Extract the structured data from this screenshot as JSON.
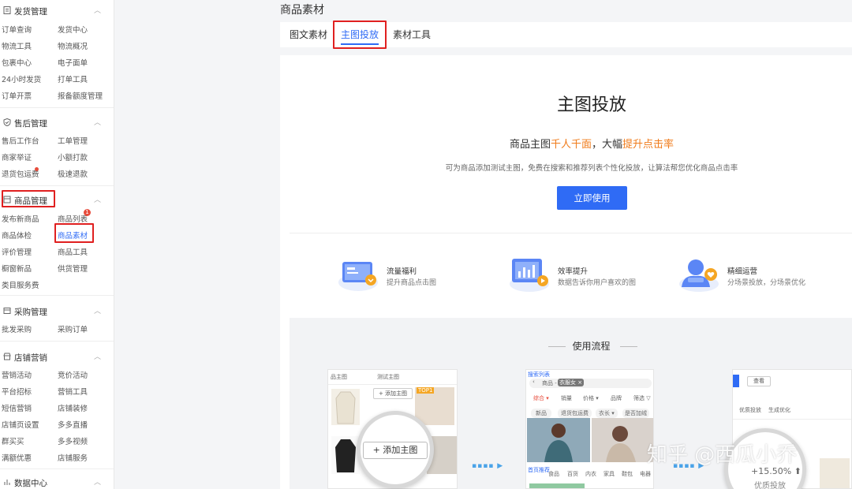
{
  "sidebar": {
    "groups": [
      {
        "title": "发货管理",
        "items": [
          "订单查询",
          "发货中心",
          "物流工具",
          "物流概况",
          "包裹中心",
          "电子面单",
          "24小时发货",
          "打单工具",
          "订单开票",
          "报备额度管理"
        ]
      },
      {
        "title": "售后管理",
        "items": [
          "售后工作台",
          "工单管理",
          "商家举证",
          "小额打款",
          "退货包运费",
          "极速退款"
        ]
      },
      {
        "title": "商品管理",
        "items": [
          "发布新商品",
          "商品列表",
          "商品体检",
          "商品素材",
          "评价管理",
          "商品工具",
          "橱窗新品",
          "供货管理",
          "类目服务费"
        ]
      },
      {
        "title": "采购管理",
        "items": [
          "批发采购",
          "采购订单"
        ]
      },
      {
        "title": "店铺营销",
        "items": [
          "营销活动",
          "竞价活动",
          "平台招标",
          "营销工具",
          "短信营销",
          "店铺装修",
          "店铺页设置",
          "多多直播",
          "群买买",
          "多多视频",
          "满额优惠",
          "店铺服务"
        ]
      },
      {
        "title": "数据中心",
        "items": []
      }
    ],
    "badge_count": "1"
  },
  "main": {
    "title": "商品素材",
    "tabs": [
      "图文素材",
      "主图投放",
      "素材工具"
    ],
    "active_tab": 1
  },
  "hero": {
    "title": "主图投放",
    "subtitle_1": "商品主图",
    "subtitle_2": "千人千面",
    "subtitle_3": "，大幅",
    "subtitle_4": "提升点击率",
    "description": "可为商品添加测试主图，免费在搜索和推荐列表个性化投放，让算法帮您优化商品点击率",
    "cta": "立即使用"
  },
  "features": [
    {
      "title": "流量福利",
      "desc": "提升商品点击图",
      "icon": "traffic-icon"
    },
    {
      "title": "效率提升",
      "desc": "数据告诉你用户喜欢的图",
      "icon": "chart-screen-icon"
    },
    {
      "title": "精细运营",
      "desc": "分场景投放，分场景优化",
      "icon": "user-heart-icon"
    }
  ],
  "flow": {
    "title": "使用流程",
    "card1": {
      "col1": "品主图",
      "col2": "测试主图",
      "add_btn": "+ 添加主图",
      "tag": "TOP1",
      "magnified": "+ 添加主图"
    },
    "card2": {
      "header": "搜索列表",
      "search_prefix": "商品 -",
      "search_chip": "衣服女 ×",
      "filters": [
        "综合 ▾",
        "销量",
        "价格 ▾",
        "品牌",
        "筛选 ▽"
      ],
      "chips": [
        "新品",
        "退货包运费",
        "衣长 ▾",
        "是否加绒"
      ],
      "bottom_header": "首页推荐",
      "bottom_tabs": [
        "食品",
        "百货",
        "内衣",
        "家具",
        "鞋包",
        "电器"
      ]
    },
    "card3": {
      "btn": "查看",
      "tab1": "优质投放",
      "tab2": "生成优化",
      "percent": "+15.50% ⬆",
      "label": "优质投放"
    }
  },
  "watermark": "知乎 @西瓜小乔",
  "colors": {
    "accent": "#2f6bf5",
    "orange": "#f07b1a",
    "red_annotation": "#e02020"
  }
}
